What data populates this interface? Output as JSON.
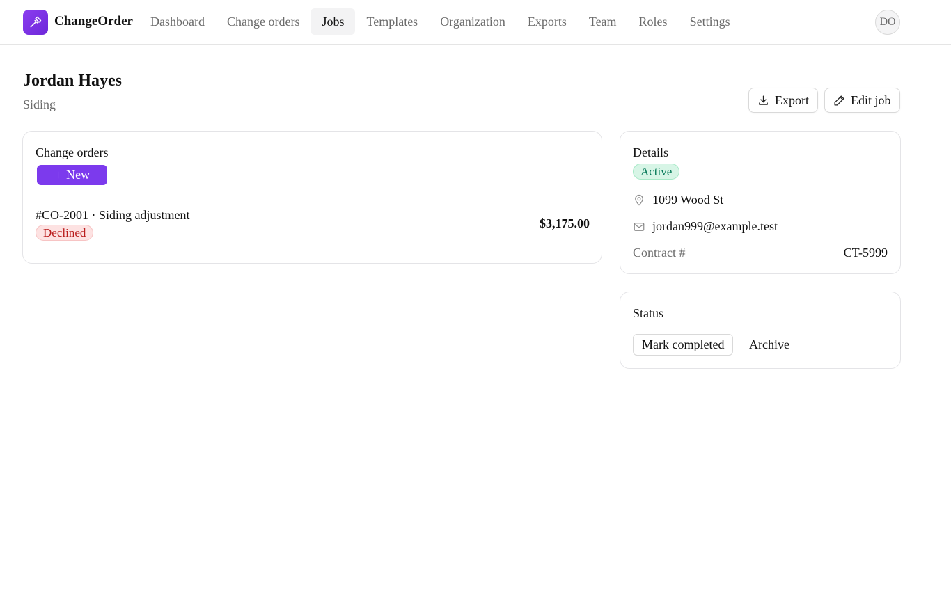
{
  "app": {
    "brand": "ChangeOrder",
    "accent_color": "#7c3aed",
    "logo_icon": "hammer-icon"
  },
  "nav": {
    "items": [
      {
        "label": "Dashboard"
      },
      {
        "label": "Change orders"
      },
      {
        "label": "Jobs",
        "active": true
      },
      {
        "label": "Templates"
      },
      {
        "label": "Organization"
      },
      {
        "label": "Exports"
      },
      {
        "label": "Team"
      },
      {
        "label": "Roles"
      },
      {
        "label": "Settings"
      }
    ]
  },
  "user": {
    "initials": "DO"
  },
  "page": {
    "title": "Jordan Hayes",
    "subtitle": "Siding",
    "export_label": "Export",
    "edit_label": "Edit job"
  },
  "change_orders": {
    "title": "Change orders",
    "new_label": "New",
    "items": [
      {
        "title": "#CO-2001 · Siding adjustment",
        "status": "Declined",
        "status_color": "#b91c1c",
        "amount": "$3,175.00"
      }
    ]
  },
  "details": {
    "title": "Details",
    "status": "Active",
    "status_color": "#047857",
    "address": "1099 Wood St",
    "email": "jordan999@example.test",
    "contract_label": "Contract #",
    "contract_value": "CT-5999"
  },
  "status_card": {
    "title": "Status",
    "mark_completed_label": "Mark completed",
    "archive_label": "Archive"
  }
}
